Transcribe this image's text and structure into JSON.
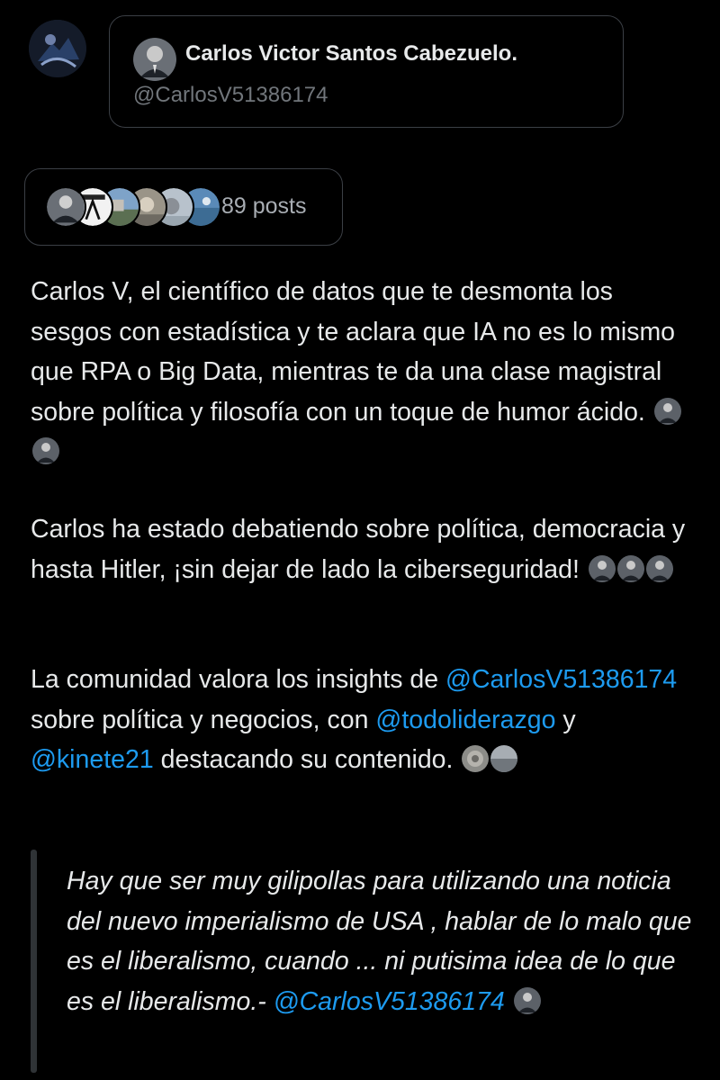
{
  "profile": {
    "name": "Carlos Victor Santos Cabezuelo.",
    "handle": "@CarlosV51386174"
  },
  "posts": {
    "count_label": "89 posts"
  },
  "summary": {
    "p1": "Carlos V, el científico de datos que te desmonta los sesgos con estadística y te aclara que IA no es lo mismo que RPA o Big Data, mientras te da una clase magistral sobre política y filosofía con un toque de humor ácido.",
    "p2": "Carlos ha estado debatiendo sobre política, democracia y hasta Hitler, ¡sin dejar de lado la ciberseguridad!",
    "p3_prefix": "La comunidad valora los insights de ",
    "p3_mention1": "@CarlosV51386174",
    "p3_mid1": " sobre política y negocios, con ",
    "p3_mention2": "@todoliderazgo",
    "p3_mid2": " y ",
    "p3_mention3": "@kinete21",
    "p3_suffix": " destacando su contenido."
  },
  "quote": {
    "text": "Hay que ser muy gilipollas para utilizando una noticia del nuevo imperialismo de USA , hablar de lo malo que es el liberalismo, cuando ... ni putisima idea de lo que es el liberalismo.-",
    "mention": "@CarlosV51386174"
  },
  "icons": {
    "user_avatar": "avatar-icon",
    "profile_avatar": "profile-avatar-icon",
    "inline_emoji": "avatar-emoji-icon"
  },
  "colors": {
    "background": "#000000",
    "text": "#e7e9ea",
    "muted": "#71767b",
    "link": "#1d9bf0",
    "border": "#3b3f45"
  }
}
